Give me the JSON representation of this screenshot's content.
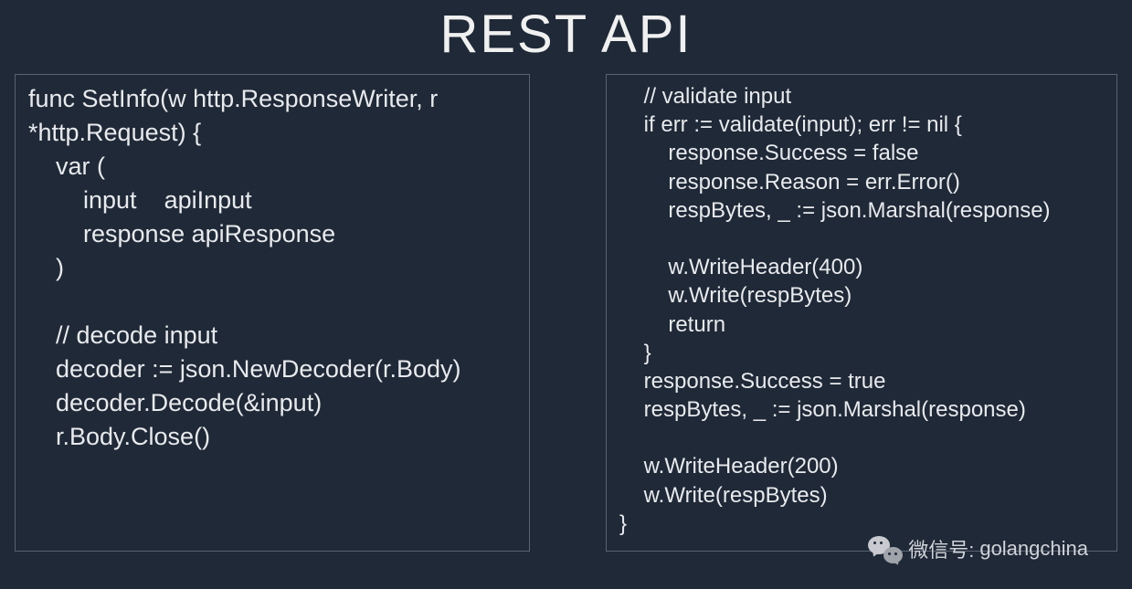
{
  "title": "REST API",
  "code": {
    "left": "func SetInfo(w http.ResponseWriter, r\n*http.Request) {\n    var (\n        input    apiInput\n        response apiResponse\n    )\n\n    // decode input\n    decoder := json.NewDecoder(r.Body)\n    decoder.Decode(&input)\n    r.Body.Close()",
    "right": "    // validate input\n    if err := validate(input); err != nil {\n        response.Success = false\n        response.Reason = err.Error()\n        respBytes, _ := json.Marshal(response)\n\n        w.WriteHeader(400)\n        w.Write(respBytes)\n        return\n    }\n    response.Success = true\n    respBytes, _ := json.Marshal(response)\n\n    w.WriteHeader(200)\n    w.Write(respBytes)\n}"
  },
  "watermark": {
    "label": "微信号:",
    "id": "golangchina"
  }
}
